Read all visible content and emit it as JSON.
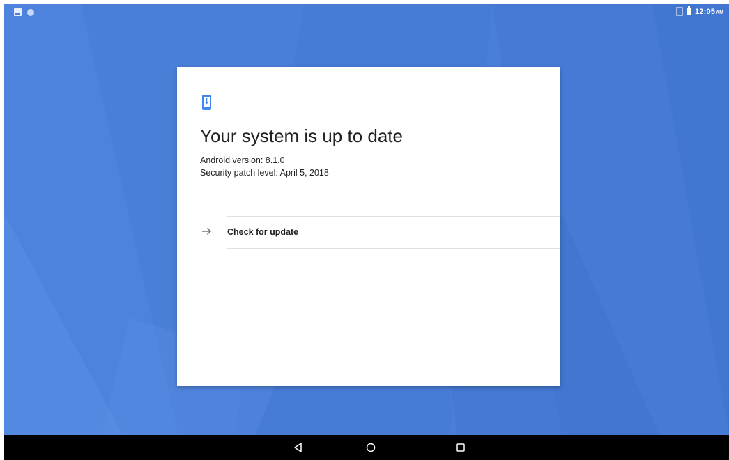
{
  "status_bar": {
    "time": "12:05",
    "ampm": "AM",
    "left_icons": [
      "image-icon",
      "circle-notification-icon"
    ],
    "right_icons": [
      "no-signal-icon",
      "battery-icon"
    ]
  },
  "card": {
    "icon": "system-update-icon",
    "title": "Your system is up to date",
    "android_version": "Android version: 8.1.0",
    "security_patch": "Security patch level: April 5, 2018",
    "check_for_update": {
      "icon": "arrow-right-icon",
      "label": "Check for update"
    }
  },
  "nav_bar": {
    "buttons": [
      "back-icon",
      "home-icon",
      "recents-icon"
    ]
  },
  "colors": {
    "wallpaper": "#4a7fd8",
    "accent": "#4285f4",
    "text": "#202124",
    "nav_bar": "#000000"
  }
}
